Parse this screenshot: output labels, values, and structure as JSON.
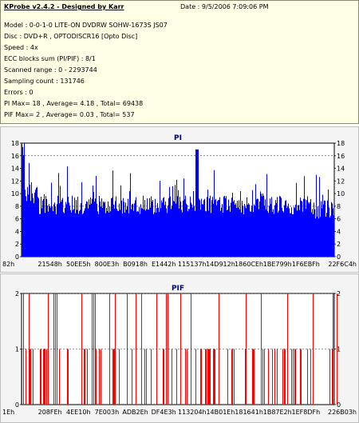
{
  "header": {
    "title": "KProbe v2.4.2 - Designed by Karr",
    "date": "Date : 9/5/2006 7:09:06 PM"
  },
  "info_lines": [
    "Model : 0-0-1-0 LITE-ON DVDRW SOHW-1673S JS07",
    "Disc : DVD+R , OPTODISCR16 [Opto Disc]",
    "Speed : 4x",
    "ECC blocks sum (PI/PIF) : 8/1",
    "Scanned range : 0 - 2293744",
    "Sampling count : 131746",
    "Errors : 0",
    "PI Max= 18 , Average= 4.18 , Total= 69438",
    "PIF Max= 2 , Average= 0.03 , Total= 537"
  ],
  "chart_data": [
    {
      "type": "bar",
      "title": "PI",
      "color": "#0000ff",
      "ylim": [
        0,
        18
      ],
      "yticks": [
        "0",
        "2",
        "4",
        "6",
        "8",
        "10",
        "12",
        "14",
        "16",
        "18"
      ],
      "dashed_at": [
        8,
        16
      ],
      "xticks": [
        "82h",
        "21548h",
        "50EE5h",
        "800E3h",
        "B0918h",
        "E1442h",
        "115137h",
        "14D912h",
        "1860CEh",
        "1BE799h",
        "1F6EBFh",
        "22F6C4h"
      ],
      "x_range": [
        "82h",
        "22F6C4h"
      ],
      "summary": {
        "max": 18,
        "average": 4.18,
        "total": 69438
      }
    },
    {
      "type": "bar",
      "title": "PIF",
      "color": "#ff0000",
      "ylim": [
        0,
        2
      ],
      "yticks": [
        "0",
        "1",
        "2"
      ],
      "dashed_at": [
        1,
        2
      ],
      "xticks": [
        "1Eh",
        "208FEh",
        "4EE10h",
        "7E003h",
        "ADB2Eh",
        "DF4E3h",
        "113204h",
        "14B01Eh",
        "181641h",
        "1B87E2h",
        "1EF8DFh",
        "226B03h"
      ],
      "x_range": [
        "1Eh",
        "226B03h"
      ],
      "summary": {
        "max": 2,
        "average": 0.03,
        "total": 537
      }
    }
  ]
}
